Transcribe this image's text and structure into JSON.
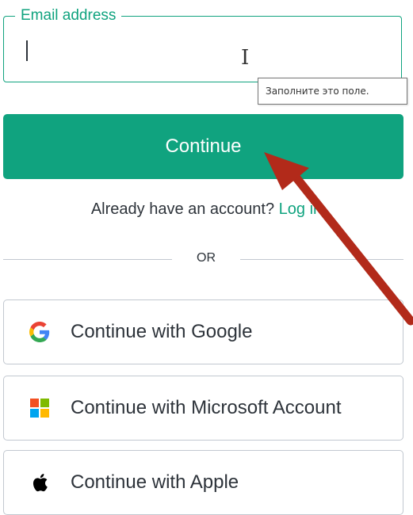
{
  "email": {
    "legend": "Email address",
    "value": "",
    "placeholder": ""
  },
  "tooltip": {
    "text": "Заполните это поле."
  },
  "continue_button": {
    "label": "Continue"
  },
  "account_prompt": {
    "text": "Already have an account?",
    "link_label": "Log in"
  },
  "divider": {
    "label": "OR"
  },
  "social_buttons": [
    {
      "label": "Continue with Google",
      "icon": "google-icon"
    },
    {
      "label": "Continue with Microsoft Account",
      "icon": "microsoft-icon"
    },
    {
      "label": "Continue with Apple",
      "icon": "apple-icon"
    }
  ],
  "colors": {
    "accent": "#10a37f",
    "text": "#2d333a",
    "border": "#c2c8d0",
    "annotation_arrow": "#b22a1a"
  }
}
